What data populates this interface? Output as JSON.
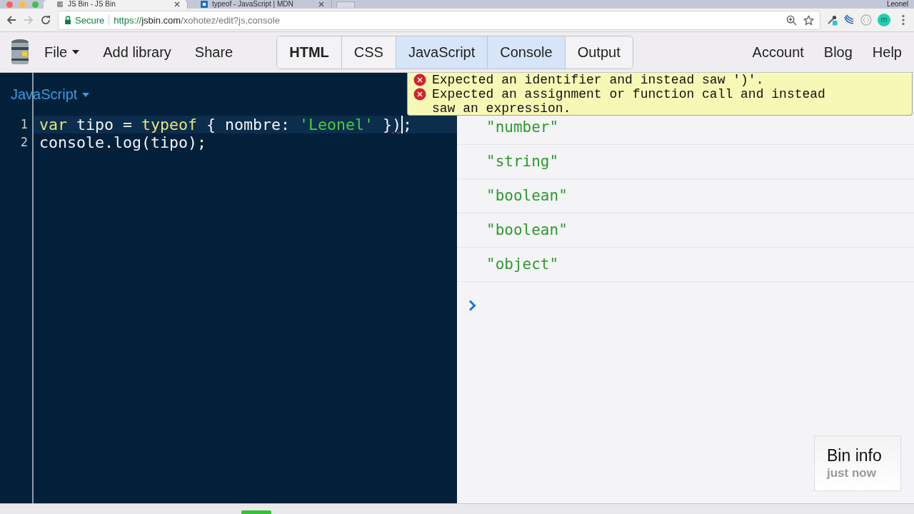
{
  "browser": {
    "tabs": [
      {
        "title": "JS Bin - JS Bin",
        "selected": true
      },
      {
        "title": "typeof - JavaScript | MDN",
        "selected": false
      }
    ],
    "profile_name": "Leonel",
    "nav": [
      {
        "kind": "back",
        "disabled": false
      },
      {
        "kind": "forward",
        "disabled": true
      },
      {
        "kind": "reload",
        "disabled": false
      }
    ],
    "security_label": "Secure",
    "url": {
      "scheme": "https://",
      "host": "jsbin.com",
      "path": "/xohotez/edit?js,console"
    },
    "extension_badge": "m"
  },
  "toolbar": {
    "menu": [
      {
        "label": "File",
        "dropdown": true
      },
      {
        "label": "Add library",
        "dropdown": false
      },
      {
        "label": "Share",
        "dropdown": false
      }
    ],
    "panels": [
      {
        "label": "HTML",
        "selected": false,
        "emphasized": true
      },
      {
        "label": "CSS",
        "selected": false,
        "emphasized": false
      },
      {
        "label": "JavaScript",
        "selected": true,
        "emphasized": false
      },
      {
        "label": "Console",
        "selected": true,
        "emphasized": false
      },
      {
        "label": "Output",
        "selected": false,
        "emphasized": false
      }
    ],
    "links": [
      "Account",
      "Blog",
      "Help"
    ]
  },
  "editor": {
    "title": "JavaScript",
    "lines": [
      {
        "number": "1",
        "highlighted": true,
        "tokens": [
          {
            "text": "var",
            "kind": "keyword",
            "error": false,
            "cursor": false
          },
          {
            "text": " tipo = ",
            "kind": "plain",
            "error": false,
            "cursor": false
          },
          {
            "text": "typeof",
            "kind": "keyword",
            "error": false,
            "cursor": false
          },
          {
            "text": " { nombre: ",
            "kind": "plain",
            "error": false,
            "cursor": false
          },
          {
            "text": "'Leonel'",
            "kind": "string",
            "error": false,
            "cursor": false
          },
          {
            "text": " }",
            "kind": "plain",
            "error": false,
            "cursor": false
          },
          {
            "text": ")",
            "kind": "plain",
            "error": true,
            "cursor": true
          },
          {
            "text": ";",
            "kind": "plain",
            "error": false,
            "cursor": false
          }
        ]
      },
      {
        "number": "2",
        "highlighted": false,
        "tokens": [
          {
            "text": "console.log(tipo);",
            "kind": "plain",
            "error": false,
            "cursor": false
          }
        ]
      }
    ]
  },
  "console": {
    "output": [
      "\"number\"",
      "\"string\"",
      "\"boolean\"",
      "\"boolean\"",
      "\"object\""
    ]
  },
  "lint_tooltip": {
    "messages": [
      "Expected an identifier and instead saw ')'.",
      "Expected an assignment or function call and instead saw an expression."
    ]
  },
  "bin_info": {
    "title": "Bin info",
    "time": "just now"
  }
}
